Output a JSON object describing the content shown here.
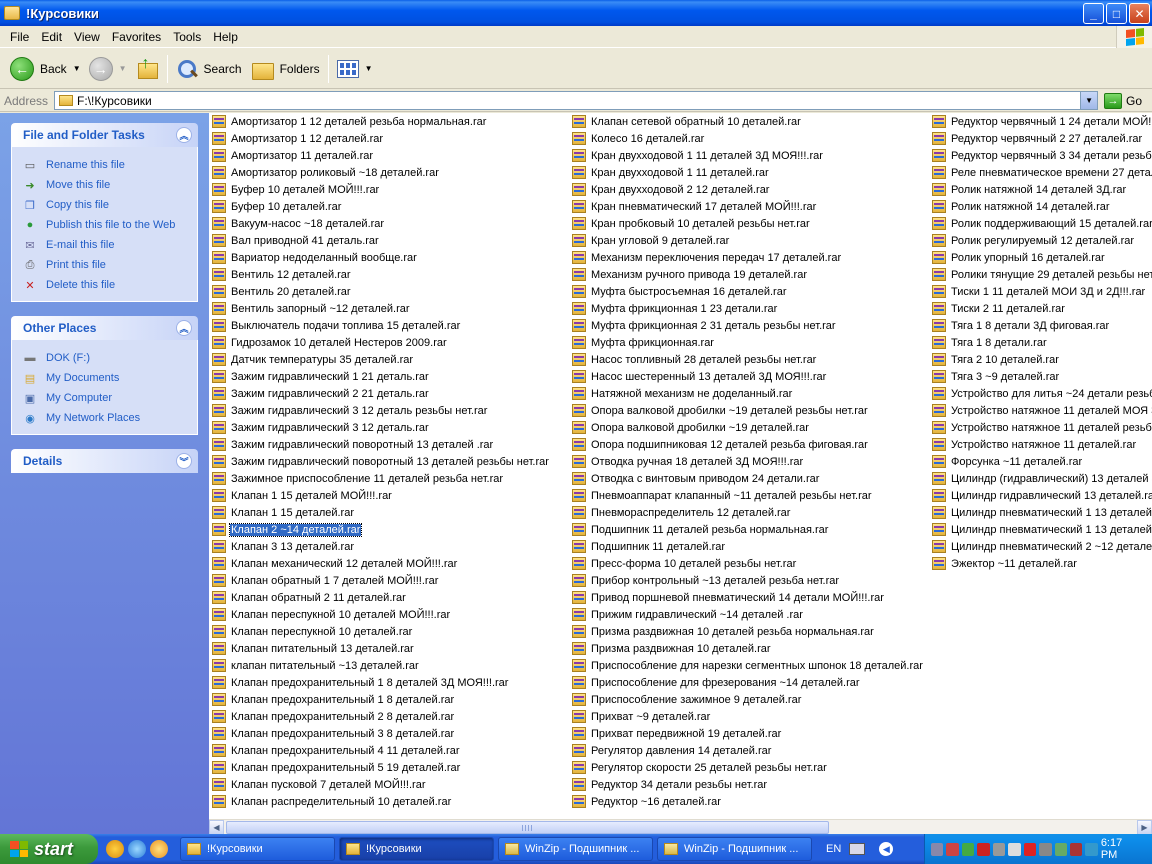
{
  "window": {
    "title": "!Курсовики"
  },
  "menu": [
    "File",
    "Edit",
    "View",
    "Favorites",
    "Tools",
    "Help"
  ],
  "toolbar": {
    "back": "Back",
    "search": "Search",
    "folders": "Folders"
  },
  "address": {
    "label": "Address",
    "path": "F:\\!Курсовики",
    "go": "Go"
  },
  "tasks_panel": {
    "title": "File and Folder Tasks",
    "items": [
      "Rename this file",
      "Move this file",
      "Copy this file",
      "Publish this file to the Web",
      "E-mail this file",
      "Print this file",
      "Delete this file"
    ]
  },
  "places_panel": {
    "title": "Other Places",
    "items": [
      "DOK (F:)",
      "My Documents",
      "My Computer",
      "My Network Places"
    ]
  },
  "details_panel": {
    "title": "Details"
  },
  "selected_file": "Клапан 2 ~14 деталей.rar",
  "files": {
    "col1": [
      "Амортизатор 1 12 деталей резьба нормальная.rar",
      "Амортизатор 1 12 деталей.rar",
      "Амортизатор 11 деталей.rar",
      "Амортизатор роликовый ~18 деталей.rar",
      "Буфер 10 деталей МОЙ!!!.rar",
      "Буфер 10 деталей.rar",
      "Вакуум-насос ~18 деталей.rar",
      "Вал приводной 41 деталь.rar",
      "Вариатор недоделанный вообще.rar",
      "Вентиль 12 деталей.rar",
      "Вентиль 20 деталей.rar",
      "Вентиль запорный ~12 деталей.rar",
      "Выключатель подачи топлива 15 деталей.rar",
      "Гидрозамок 10 деталей Нестеров 2009.rar",
      "Датчик температуры 35 деталей.rar",
      "Зажим гидравлический 1 21 деталь.rar",
      "Зажим гидравлический 2 21 деталь.rar",
      "Зажим гидравлический 3 12 деталь резьбы нет.rar",
      "Зажим гидравлический 3 12 деталь.rar",
      "Зажим гидравлический поворотный 13 деталей .rar",
      "Зажим гидравлический поворотный 13 деталей резьбы нет.rar",
      "Зажимное приспособление 11 деталей резьба нет.rar",
      "Клапан 1 15 деталей МОЙ!!!.rar",
      "Клапан 1 15 деталей.rar",
      "Клапан 2 ~14 деталей.rar",
      "Клапан 3 13 деталей.rar",
      "Клапан механический 12 деталей МОЙ!!!.rar",
      "Клапан обратный 1 7 деталей МОЙ!!!.rar",
      "Клапан обратный 2 11 деталей.rar",
      "Клапан переспукной 10 деталей МОЙ!!!.rar",
      "Клапан переспукной 10 деталей.rar",
      "Клапан питательный 13 деталей.rar",
      "клапан питательный ~13 деталей.rar",
      "Клапан предохранительный 1 8 деталей 3Д МОЯ!!!.rar",
      "Клапан предохранительный 1 8 деталей.rar",
      "Клапан предохранительный 2 8 деталей.rar",
      "Клапан предохранительный 3 8 деталей.rar",
      "Клапан предохранительный 4 11 деталей.rar",
      "Клапан предохранительный 5 19 деталей.rar",
      "Клапан пусковой 7 деталей МОЙ!!!.rar",
      "Клапан распределительный 10 деталей.rar"
    ],
    "col2": [
      "Клапан сетевой обратный 10 деталей.rar",
      "Колесо 16 деталей.rar",
      "Кран двухходовой 1 11 деталей 3Д МОЯ!!!.rar",
      "Кран двухходовой 1 11 деталей.rar",
      "Кран двухходовой 2 12 деталей.rar",
      "Кран пневматический 17 деталей МОЙ!!!.rar",
      "Кран пробковый 10 деталей резьбы нет.rar",
      "Кран угловой 9 деталей.rar",
      "Механизм переключения передач 17 деталей.rar",
      "Механизм ручного привода 19 деталей.rar",
      "Муфта быстросъемная 16 деталей.rar",
      "Муфта фрикционная 1 23 детали.rar",
      "Муфта фрикционная 2 31 деталь резьбы нет.rar",
      "Муфта фрикционная.rar",
      "Насос топливный 28 деталей резьбы нет.rar",
      "Насос шестеренный 13 деталей 3Д МОЯ!!!.rar",
      "Натяжной механизм не доделанный.rar",
      "Опора валковой дробилки ~19 деталей резьбы нет.rar",
      "Опора валковой дробилки ~19 деталей.rar",
      "Опора подшипниковая 12 деталей резьба фиговая.rar",
      "Отводка ручная 18 деталей 3Д МОЯ!!!.rar",
      "Отводка с винтовым приводом 24 детали.rar",
      "Пневмоаппарат клапанный ~11 деталей резьбы нет.rar",
      "Пневмораспределитель 12 деталей.rar",
      "Подшипник 11 деталей резьба нормальная.rar",
      "Подшипник 11 деталей.rar",
      "Пресс-форма 10 деталей резьбы нет.rar",
      "Прибор контрольный ~13 деталей резьба нет.rar",
      "Привод поршневой пневматический 14 детали МОЙ!!!.rar",
      "Прижим гидравлический ~14 деталей .rar",
      "Призма раздвижная 10 деталей резьба нормальная.rar",
      "Призма раздвижная 10 деталей.rar",
      "Приспособление для нарезки сегментных шпонок 18 деталей.rar",
      "Приспособление для фрезерования ~14 деталей.rar",
      "Приспособление зажимное 9 деталей.rar",
      "Прихват ~9 деталей.rar",
      "Прихват передвижной 19 деталей.rar",
      "Регулятор давления 14 деталей.rar",
      "Регулятор скорости 25 деталей резьбы нет.rar",
      "Редуктор 34 детали резьбы нет.rar",
      "Редуктор ~16 деталей.rar"
    ],
    "col3": [
      "Редуктор червячный 1 24 детали МОЙ!!!",
      "Редуктор червячный 2 27 деталей.rar",
      "Редуктор червячный 3 34 детали резьб",
      "Реле пневматическое времени 27 детал",
      "Ролик натяжной 14 деталей 3Д.rar",
      "Ролик натяжной 14 деталей.rar",
      "Ролик поддерживающий 15 деталей.rar",
      "Ролик регулируемый 12 деталей.rar",
      "Ролик упорный 16 деталей.rar",
      "Ролики тянущие 29 деталей резьбы нет",
      "Тиски 1 11 деталей МОИ 3Д и 2Д!!!.rar",
      "Тиски 2 11 деталей.rar",
      "Тяга 1 8 детали 3Д фиговая.rar",
      "Тяга 1 8 детали.rar",
      "Тяга 2 10 деталей.rar",
      "Тяга 3 ~9 деталей.rar",
      "Устройство для литья ~24 детали резьб",
      "Устройство натяжное 11 деталей МОЯ 3",
      "Устройство натяжное 11 деталей резьб",
      "Устройство натяжное 11 деталей.rar",
      "Форсунка ~11 деталей.rar",
      "Цилиндр (гидравлический) 13 деталей 3",
      "Цилиндр гидравлический 13 деталей.ra",
      "Цилиндр пневматический 1 13 деталей",
      "Цилиндр пневматический 1 13 деталей.",
      "Цилиндр пневматический 2 ~12 детале",
      "Эжектор ~11 деталей.rar"
    ]
  },
  "taskbar": {
    "start": "start",
    "buttons": [
      "!Курсовики",
      "!Курсовики",
      "WinZip - Подшипник ...",
      "WinZip - Подшипник ..."
    ],
    "language": "EN",
    "clock": "6:17 PM"
  }
}
